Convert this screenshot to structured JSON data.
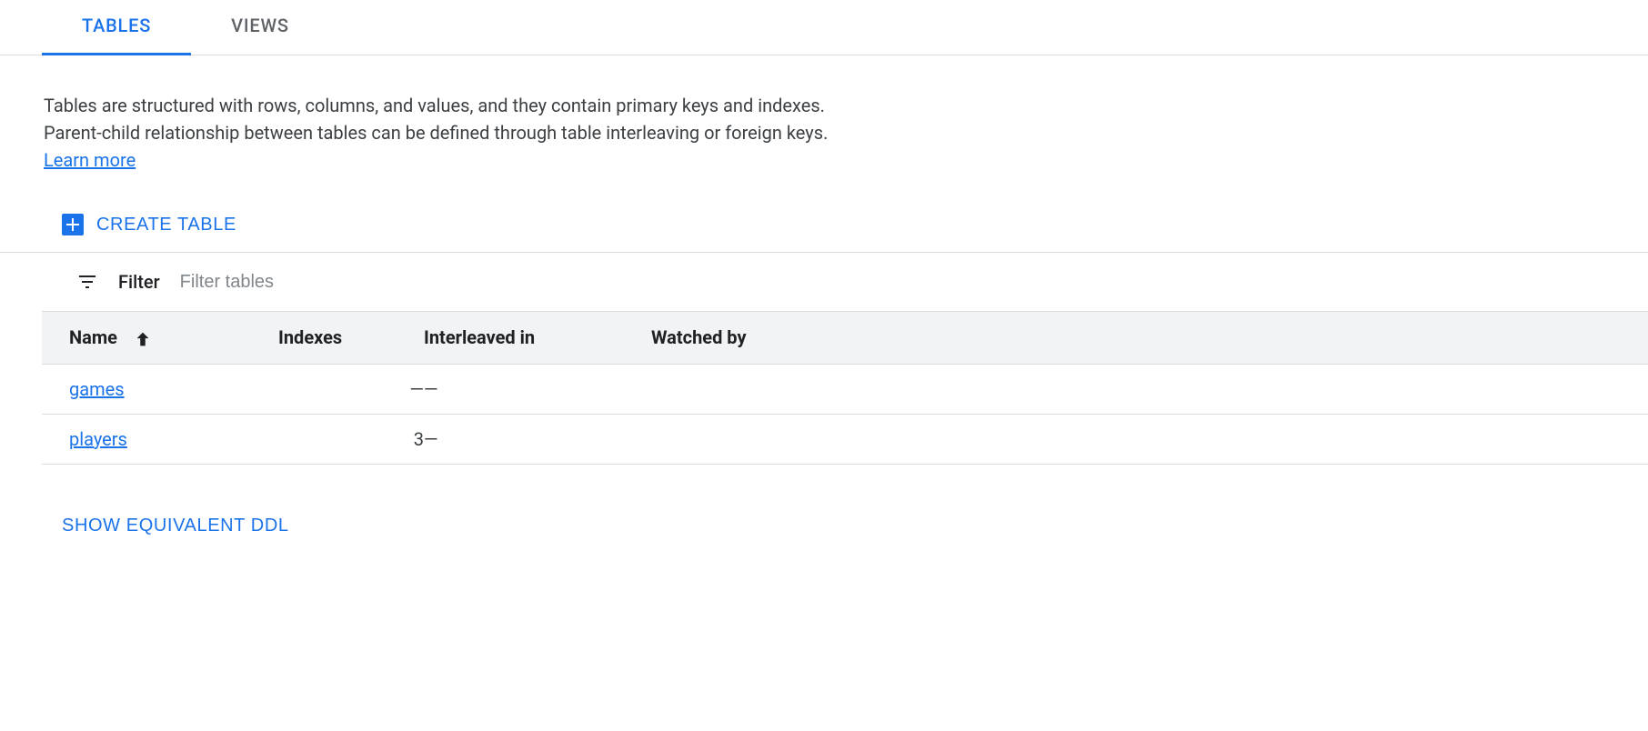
{
  "tabs": {
    "tables": "TABLES",
    "views": "VIEWS"
  },
  "description": {
    "text": "Tables are structured with rows, columns, and values, and they contain primary keys and indexes. Parent-child relationship between tables can be defined through table interleaving or foreign keys. ",
    "learn_more": "Learn more"
  },
  "toolbar": {
    "create_table": "CREATE TABLE"
  },
  "filter": {
    "label": "Filter",
    "placeholder": "Filter tables"
  },
  "columns": {
    "name": "Name",
    "indexes": "Indexes",
    "interleaved": "Interleaved in",
    "watched_by": "Watched by"
  },
  "rows": [
    {
      "name": "games",
      "indexes": "—",
      "interleaved": "—",
      "watched_by": ""
    },
    {
      "name": "players",
      "indexes": "3",
      "interleaved": "—",
      "watched_by": ""
    }
  ],
  "footer": {
    "show_ddl": "SHOW EQUIVALENT DDL"
  }
}
